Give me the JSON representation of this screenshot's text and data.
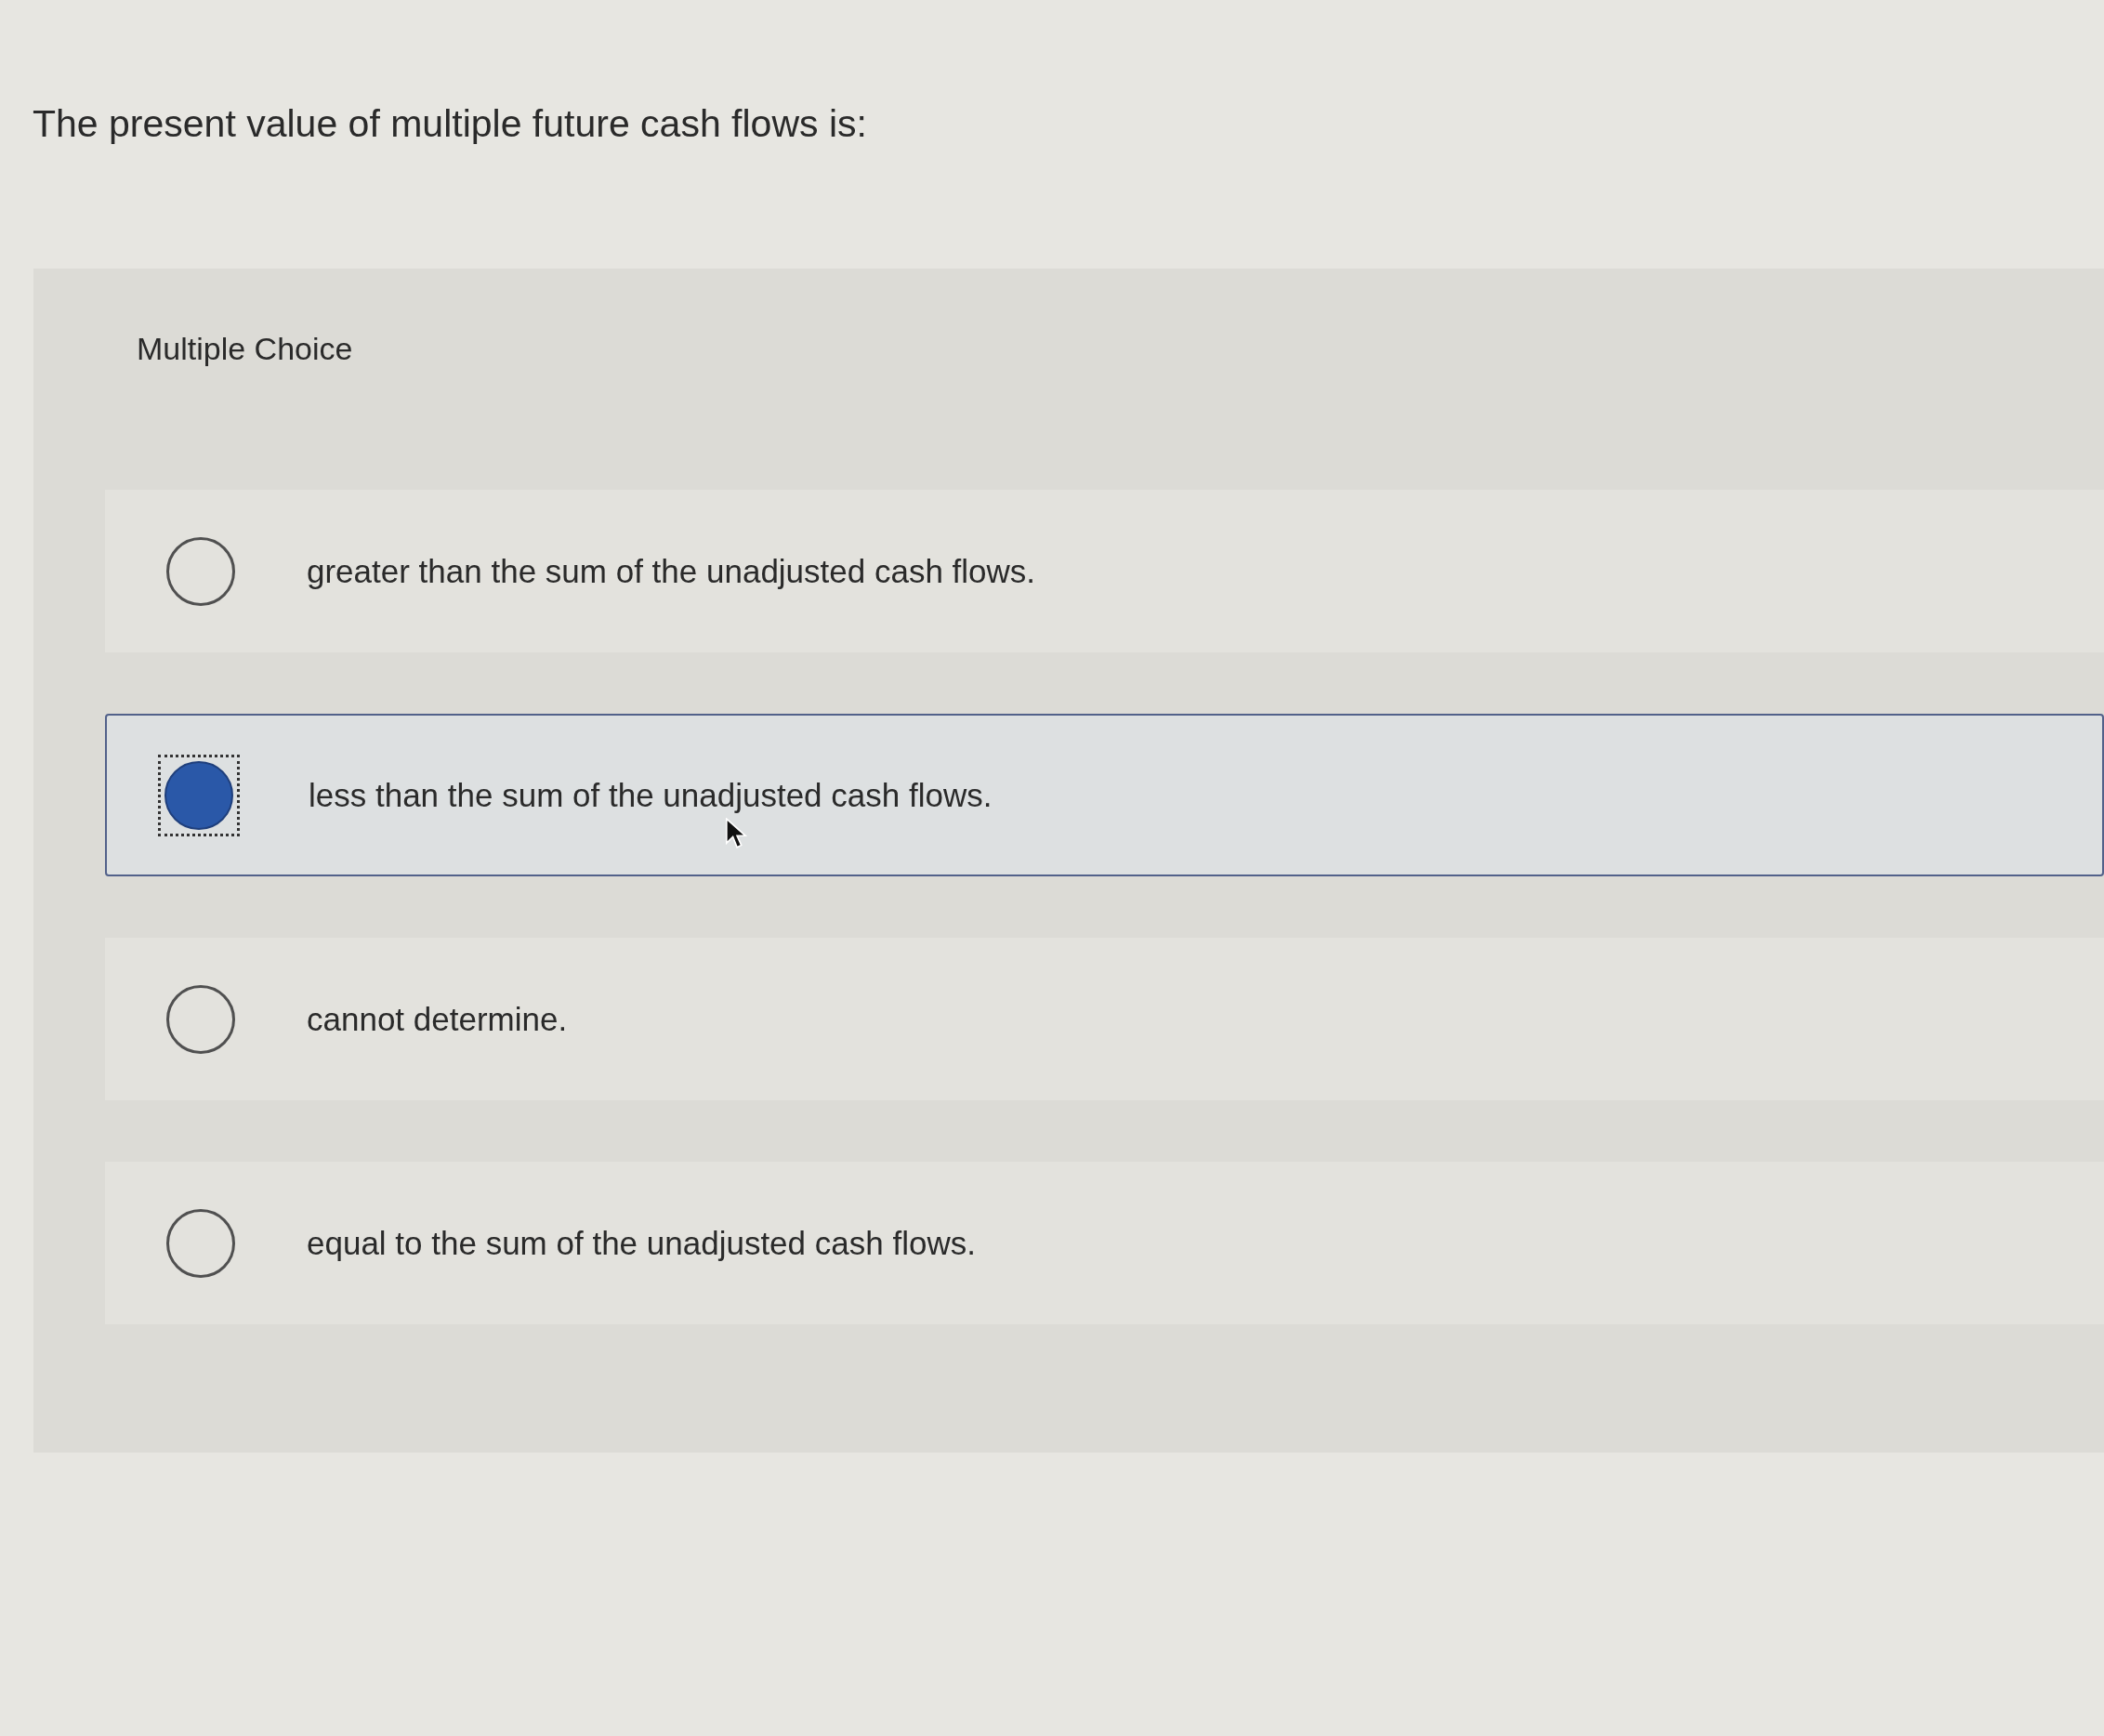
{
  "question": {
    "text": "The present value of multiple future cash flows is:"
  },
  "panel": {
    "label": "Multiple Choice",
    "options": [
      {
        "text": "greater than the sum of the unadjusted cash flows.",
        "selected": false
      },
      {
        "text": "less than the sum of the unadjusted cash flows.",
        "selected": true
      },
      {
        "text": "cannot determine.",
        "selected": false
      },
      {
        "text": "equal to the sum of the unadjusted cash flows.",
        "selected": false
      }
    ]
  }
}
